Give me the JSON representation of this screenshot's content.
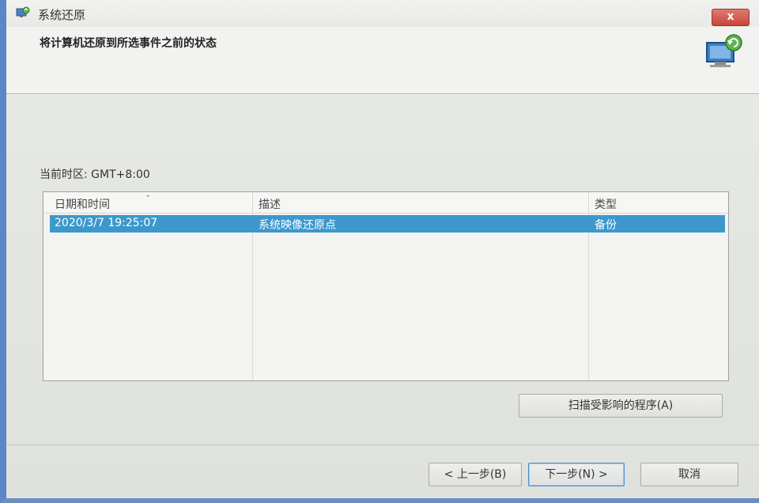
{
  "window": {
    "title": "系统还原",
    "close_label": "x"
  },
  "header": {
    "title": "将计算机还原到所选事件之前的状态"
  },
  "timezone": {
    "label": "当前时区: GMT+8:00"
  },
  "table": {
    "columns": [
      "日期和时间",
      "描述",
      "类型"
    ],
    "rows": [
      {
        "datetime": "2020/3/7 19:25:07",
        "description": "系统映像还原点",
        "type": "备份",
        "selected": true
      }
    ]
  },
  "buttons": {
    "scan": "扫描受影响的程序(A)",
    "back": "< 上一步(B)",
    "next": "下一步(N) >",
    "cancel": "取消"
  },
  "icons": {
    "title": "system-restore-icon",
    "header": "system-restore-monitor-icon",
    "close": "close-icon",
    "sort": "chevron-down-icon"
  },
  "colors": {
    "selection": "#3c98cc",
    "close_button": "#c8463a",
    "window_border": "#5a88c7"
  }
}
